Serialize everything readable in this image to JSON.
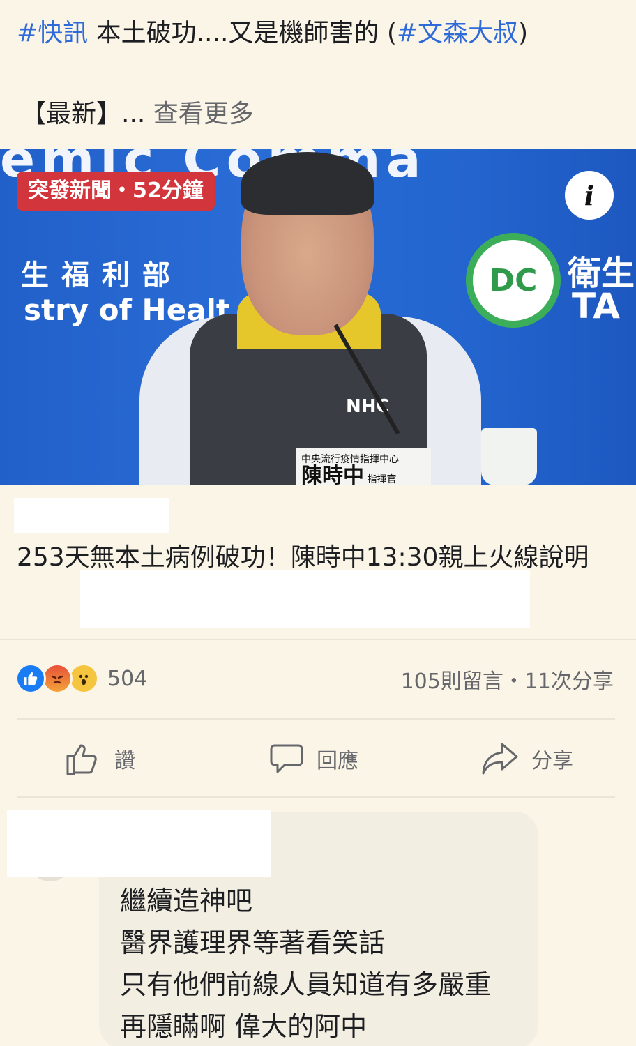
{
  "post": {
    "hashtag_1": "#快訊",
    "text_1": " 本土破功....又是機師害的 (",
    "hashtag_2": "#文森大叔",
    "text_2": ")",
    "more_prefix": "【最新】...",
    "more_link": " 查看更多"
  },
  "media": {
    "badge": "突發新聞・52分鐘",
    "info_icon": "i",
    "banner_top": "emic Comma",
    "backdrop_text_1": "生福利部",
    "backdrop_text_2": "stry of Healt",
    "backdrop_text_3": "衛生",
    "backdrop_text_4": "TA",
    "logo_text": "DC",
    "vest_text": "NHC",
    "nameplate_small": "中央流行疫情指揮中心",
    "nameplate_big": "陳時中",
    "nameplate_title": "指揮官"
  },
  "headline": "253天無本土病例破功！陳時中13:30親上火線說明",
  "engagement": {
    "reaction_count": "504",
    "stats": "105則留言・11次分享"
  },
  "actions": {
    "like": "讚",
    "comment": "回應",
    "share": "分享"
  },
  "comment": {
    "lines": [
      "繼續造神吧",
      "醫界護理界等著看笑話",
      "只有他們前線人員知道有多嚴重",
      "再隱瞞啊  偉大的阿中"
    ]
  },
  "colors": {
    "background": "#fbf5e8",
    "hashtag": "#2f6bd8",
    "badge": "#d2353b",
    "secondary_text": "#65676b",
    "like_blue": "#1a7cf4"
  }
}
